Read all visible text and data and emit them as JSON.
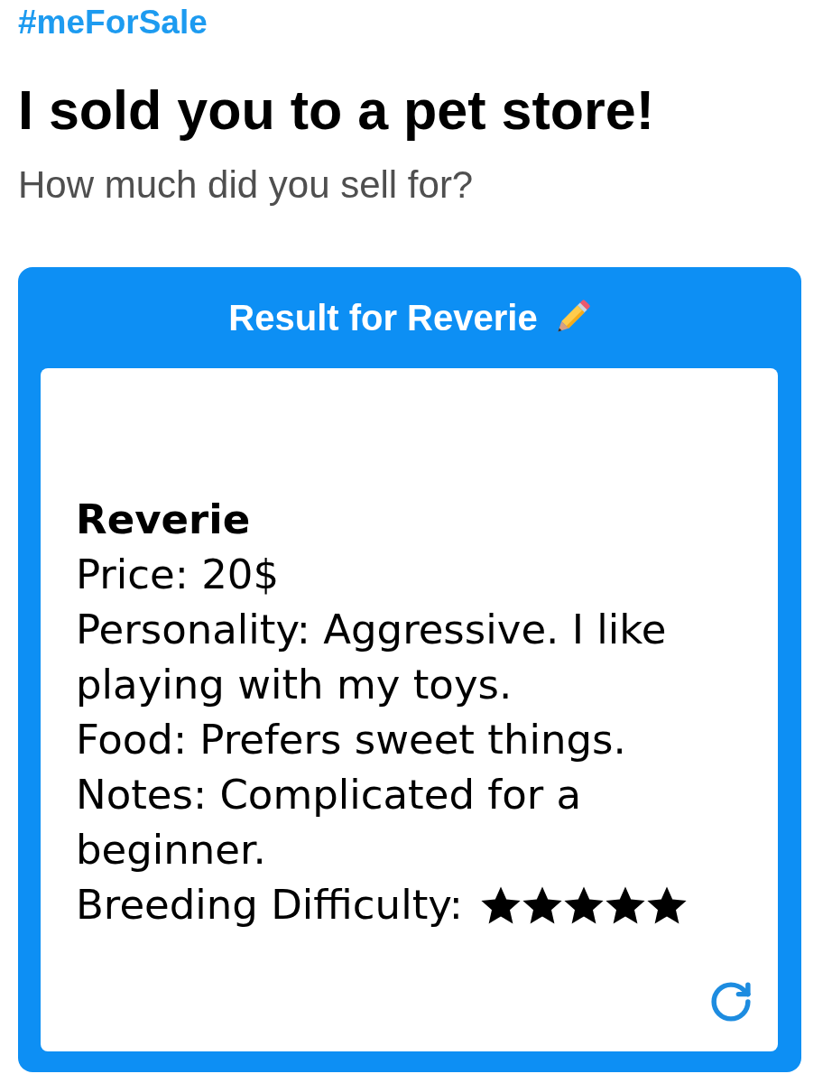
{
  "hashtag": "#meForSale",
  "title": "I sold you to a pet store!",
  "subtitle": "How much did you sell for?",
  "result": {
    "heading": "Result for Reverie",
    "name": "Reverie",
    "lines": [
      "Price: 20$",
      "Personality: Aggressive. I like playing with my toys.",
      "Food: Prefers sweet things.",
      "Notes: Complicated for a beginner."
    ],
    "difficulty": {
      "label": "Breeding Difficulty:",
      "stars": 5
    }
  }
}
